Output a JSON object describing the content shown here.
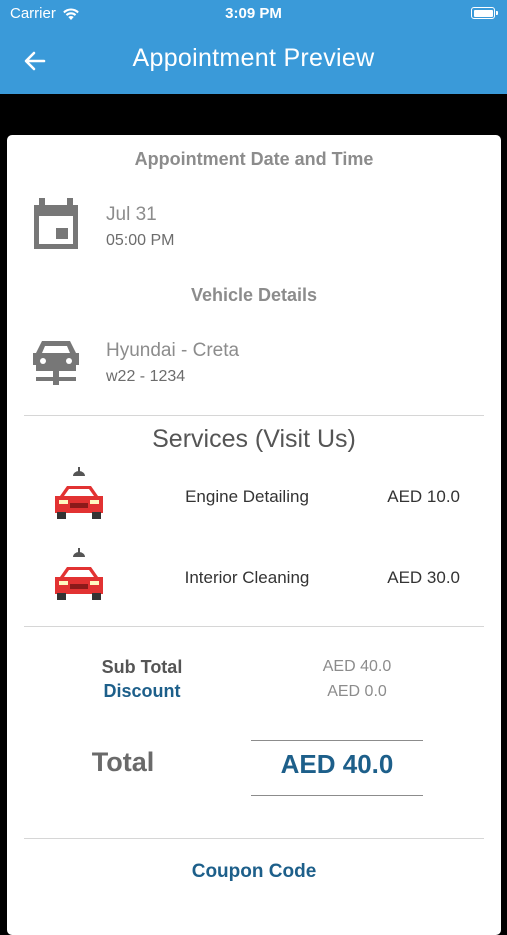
{
  "status_bar": {
    "carrier": "Carrier",
    "time": "3:09 PM"
  },
  "nav": {
    "title": "Appointment Preview"
  },
  "appointment": {
    "heading": "Appointment Date and Time",
    "date": "Jul 31",
    "time": "05:00 PM"
  },
  "vehicle": {
    "heading": "Vehicle Details",
    "model": "Hyundai - Creta",
    "plate": "w22 - 1234"
  },
  "services": {
    "heading": "Services (Visit Us)",
    "items": [
      {
        "name": "Engine Detailing",
        "price": "AED 10.0"
      },
      {
        "name": "Interior Cleaning",
        "price": "AED 30.0"
      }
    ]
  },
  "summary": {
    "subtotal_label": "Sub Total",
    "subtotal_value": "AED 40.0",
    "discount_label": "Discount",
    "discount_value": "AED 0.0",
    "total_label": "Total",
    "total_value": "AED 40.0"
  },
  "coupon": {
    "label": "Coupon Code"
  },
  "colors": {
    "header": "#3a9ad9",
    "accent": "#1d5f8a",
    "muted_text": "#8c8c8c",
    "car_red": "#e23232"
  },
  "icons": {
    "back": "arrow-left-icon",
    "calendar": "calendar-icon",
    "vehicle": "car-front-icon",
    "service": "car-wash-icon"
  }
}
